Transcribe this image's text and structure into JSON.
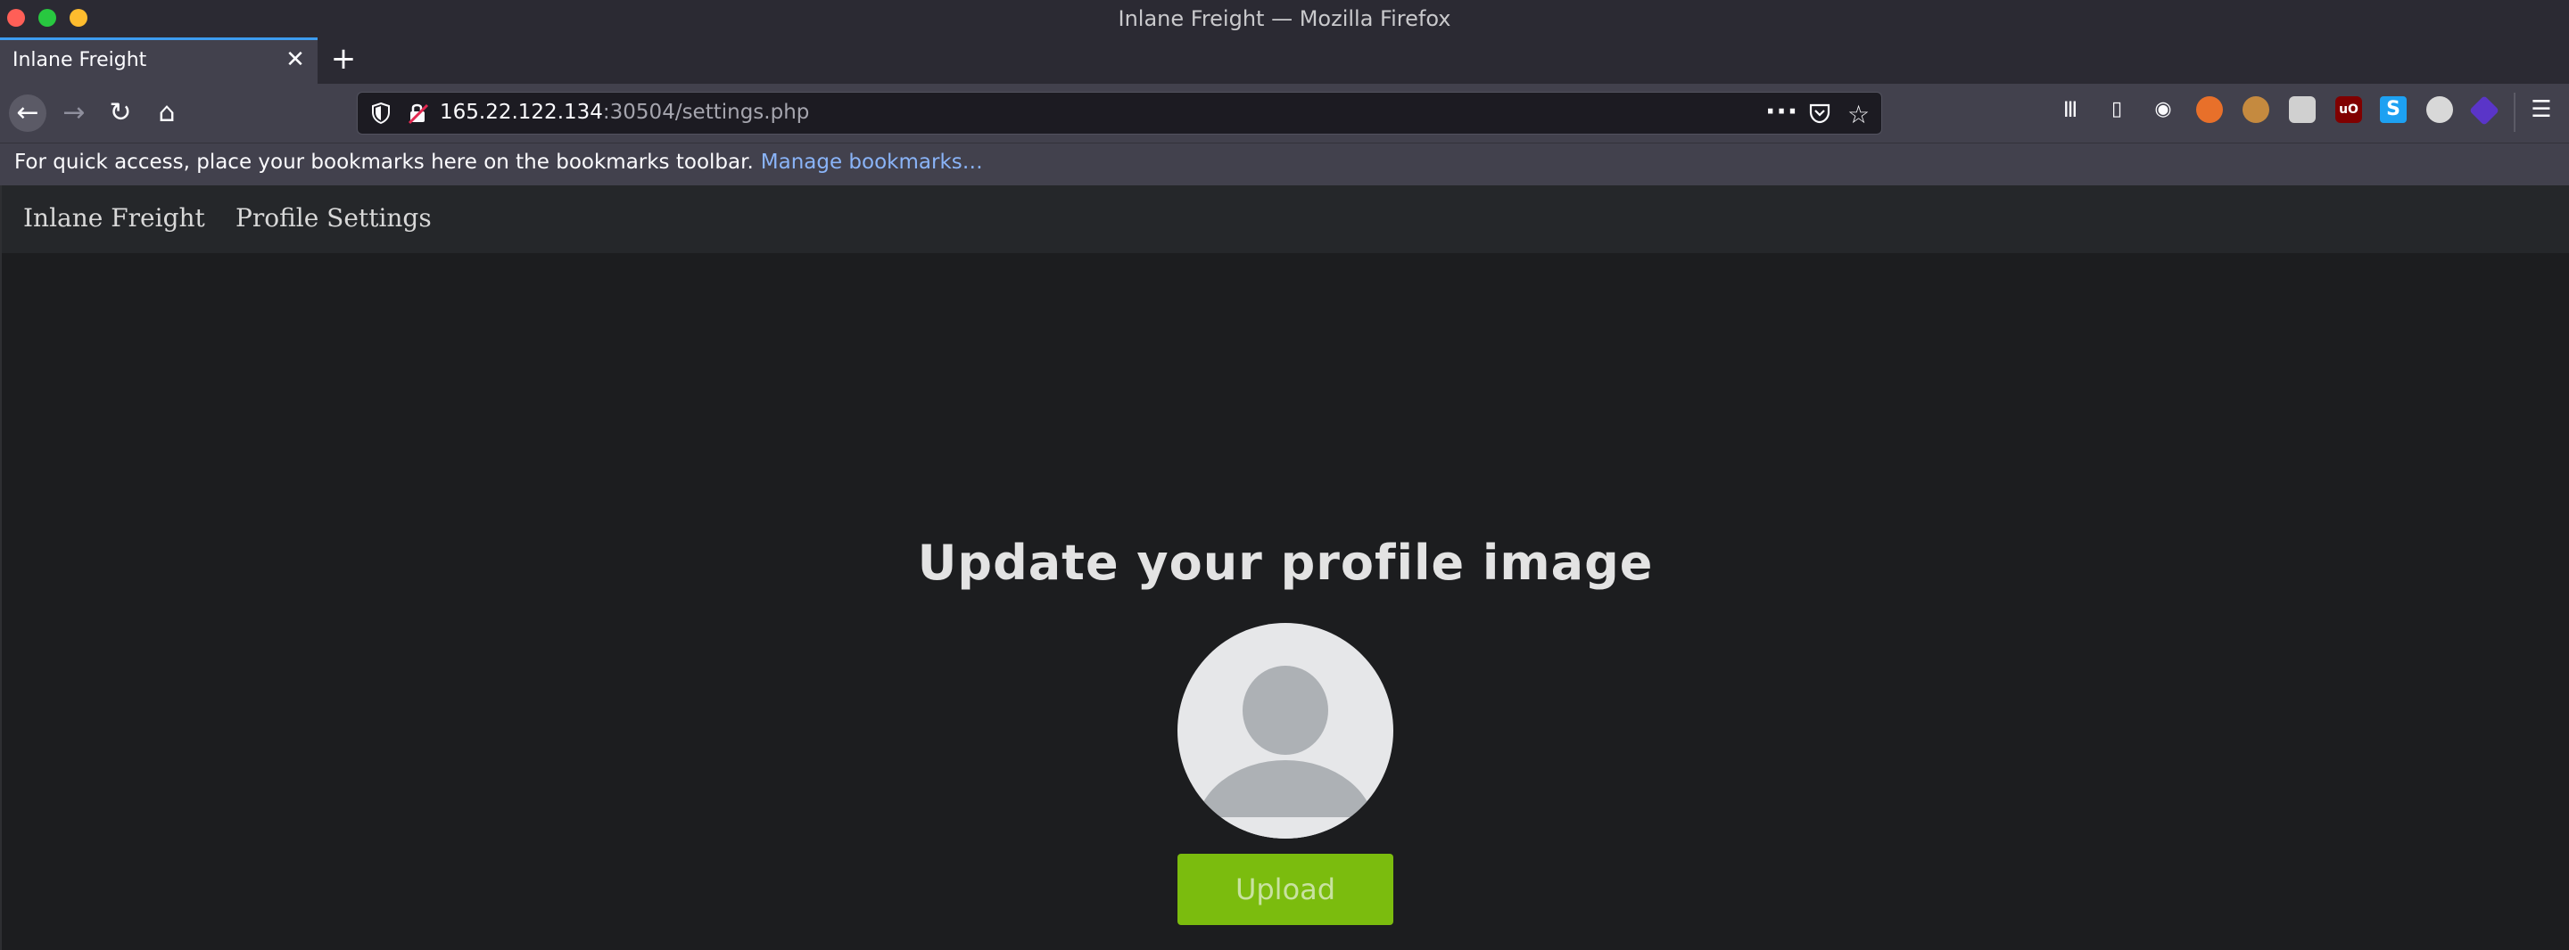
{
  "window": {
    "title": "Inlane Freight — Mozilla Firefox"
  },
  "tabs": [
    {
      "title": "Inlane Freight",
      "active": true
    }
  ],
  "urlbar": {
    "host": "165.22.122.134",
    "path": ":30504/settings.php"
  },
  "bookmarks_bar": {
    "hint": "For quick access, place your bookmarks here on the bookmarks toolbar.",
    "manage_link": "Manage bookmarks…"
  },
  "site_nav": {
    "brand": "Inlane Freight",
    "profile_settings": "Profile Settings"
  },
  "main": {
    "heading": "Update your profile image",
    "upload_label": "Upload"
  },
  "colors": {
    "accent_tab": "#3d9cf0",
    "upload_button": "#7bbc0e",
    "page_background": "#1c1d1f"
  },
  "toolbar_icons": [
    "library-icon",
    "sidebar-icon",
    "account-icon",
    "firefox-ext-icon",
    "cookie-ext-icon",
    "ext-icon",
    "ublock-icon",
    "s-ext-icon",
    "mask-ext-icon",
    "proxy-ext-icon",
    "menu-icon"
  ]
}
